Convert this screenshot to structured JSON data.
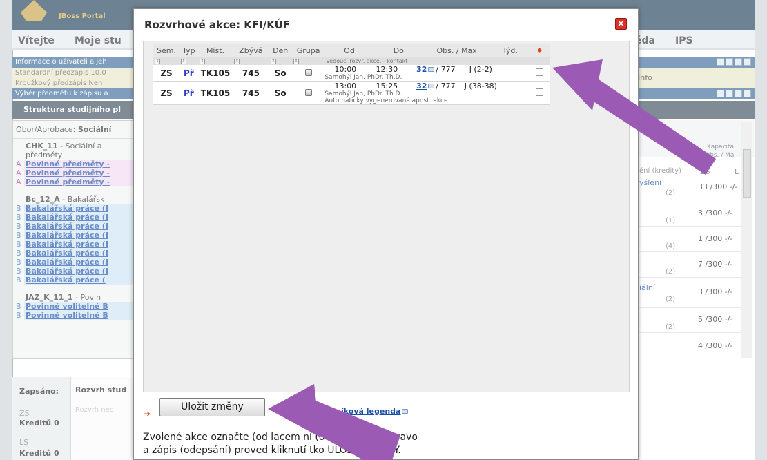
{
  "portal": {
    "logo_text": "JBoss Portal",
    "nav": [
      "Vítejte",
      "Moje stu",
      "ěda",
      "IPS"
    ],
    "strips": [
      "Informace o uživateli a jeh",
      "Standardní předzápis  10.0",
      "Kroužkový předzápis  Nen",
      "Výběr předmětu k zápisu a"
    ],
    "info_label": "Info",
    "struct_title": "Struktura studijního pl",
    "obor_label": "Obor/Aprobace:",
    "obor_value": "Sociální",
    "group1": {
      "code": "CHK_11",
      "text": " - Sociální a předměty"
    },
    "group1_links": [
      "Povinné předměty -",
      "Povinné předměty -",
      "Povinné předměty -"
    ],
    "group2": {
      "code": "Bc_12_A",
      "text": " - Bakalářsk"
    },
    "group2_links": [
      "Bakalářská práce (I",
      "Bakalářská práce (I",
      "Bakalářská práce (I",
      "Bakalářská práce (I",
      "Bakalářská práce (I",
      "Bakalářská práce (I",
      "Bakalářská práce (I",
      "Bakalářská práce (I",
      "Bakalářská práce ("
    ],
    "group3": {
      "code": "JAZ_K_11_1",
      "text": " - Povin"
    },
    "group3_links": [
      "Povinně volitelné B",
      "Povinně volitelné B"
    ],
    "right_header": [
      "Kapacita",
      "Obs. / Ma",
      "ZS",
      "L",
      "ění (kredity)"
    ],
    "right_rows": [
      {
        "label": "yšlení",
        "credits": "(2)",
        "cap": "33 /300  -/-"
      },
      {
        "label": "",
        "credits": "(1)",
        "cap": "3 /300  -/-"
      },
      {
        "label": "",
        "credits": "(4)",
        "cap": "1 /300  -/-"
      },
      {
        "label": "",
        "credits": "(2)",
        "cap": "7 /300  -/-"
      },
      {
        "label": "iální",
        "credits": "(2)",
        "cap": "3 /300  -/-"
      },
      {
        "label": "",
        "credits": "(2)",
        "cap": "5 /300  -/-"
      },
      {
        "label": "",
        "credits": "",
        "cap": "4 /300  -/-"
      }
    ],
    "bottom": {
      "zapsano": "Zapsáno:",
      "rozvrh": "Rozvrh stud",
      "rozvrh2": "Rozvrh neo",
      "zs": "ZS",
      "kredity_zs": "Kreditů  0",
      "ls": "LS",
      "kredity_ls": "Kreditů  0"
    }
  },
  "modal": {
    "title": "Rozvrhové akce: KFI/KÚF",
    "close_symbol": "×",
    "headers": [
      "Sem.",
      "Typ",
      "Míst.",
      "Zbývá",
      "Den",
      "Grupa",
      "Od",
      "Do",
      "Obs. / Max",
      "Týd."
    ],
    "sort_note": "Vedoucí rozvr. akce. - kontakt",
    "rows": [
      {
        "sem": "ZS",
        "typ": "Př",
        "mist": "TK105",
        "zbyva": "745",
        "den": "So",
        "od": "10:00",
        "do": "12:30",
        "obs": "32",
        "max": "/ 777",
        "tyd": "J (2-2)",
        "teacher": "Samohýl Jan, PhDr. Th.D.",
        "note": ""
      },
      {
        "sem": "ZS",
        "typ": "Př",
        "mist": "TK105",
        "zbyva": "745",
        "den": "So",
        "od": "13:00",
        "do": "15:25",
        "obs": "32",
        "max": "/ 777",
        "tyd": "J (38-38)",
        "teacher": "Samohýl Jan, PhDr. Th.D.",
        "note": "Automaticky vygenerovaná apost. akce"
      }
    ],
    "save_button": "Uložit změny",
    "legend_link": "íková legenda",
    "info_line1": "Zvolené akce označte (od      lacem           ní (odškrtnutím) vpravo",
    "info_line2": "a zápis (odepsání) proved     kliknutí          tko ULOŽIT ZMĚNY."
  },
  "colors": {
    "annotation_arrow": "#9b5ab4",
    "title_bar": "#1f3f58"
  }
}
